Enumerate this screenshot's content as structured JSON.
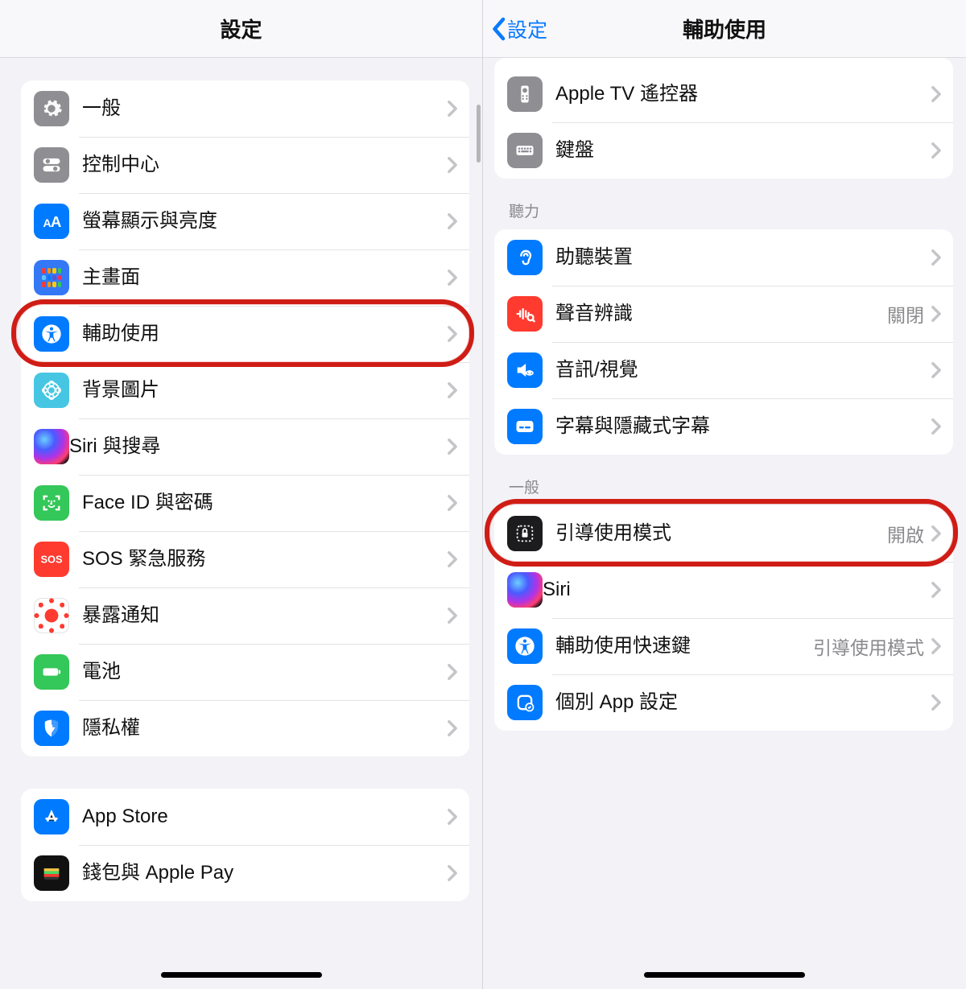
{
  "left": {
    "title": "設定",
    "groups": [
      {
        "rows": [
          {
            "label": "一般",
            "icon": "gear-icon",
            "bg": "bg-gray"
          },
          {
            "label": "控制中心",
            "icon": "toggles-icon",
            "bg": "bg-gray"
          },
          {
            "label": "螢幕顯示與亮度",
            "icon": "text-size-icon",
            "bg": "bg-blue"
          },
          {
            "label": "主畫面",
            "icon": "home-grid-icon",
            "bg": "bg-indigo"
          },
          {
            "label": "輔助使用",
            "icon": "accessibility-icon",
            "bg": "bg-blue",
            "highlight": true
          },
          {
            "label": "背景圖片",
            "icon": "wallpaper-icon",
            "bg": "bg-teal"
          },
          {
            "label": "Siri 與搜尋",
            "icon": "siri-icon",
            "bg": "bg-darkb"
          },
          {
            "label": "Face ID 與密碼",
            "icon": "faceid-icon",
            "bg": "bg-green"
          },
          {
            "label": "SOS 緊急服務",
            "icon": "sos-icon",
            "bg": "bg-red"
          },
          {
            "label": "暴露通知",
            "icon": "exposure-icon",
            "bg": "bg-white"
          },
          {
            "label": "電池",
            "icon": "battery-icon",
            "bg": "bg-green"
          },
          {
            "label": "隱私權",
            "icon": "privacy-icon",
            "bg": "bg-blue"
          }
        ]
      },
      {
        "rows": [
          {
            "label": "App Store",
            "icon": "appstore-icon",
            "bg": "bg-blue"
          },
          {
            "label": "錢包與 Apple Pay",
            "icon": "wallet-icon",
            "bg": "bg-black"
          }
        ]
      }
    ]
  },
  "right": {
    "back_label": "設定",
    "title": "輔助使用",
    "top_group": {
      "rows": [
        {
          "label": "Apple TV 遙控器",
          "icon": "remote-icon",
          "bg": "bg-gray"
        },
        {
          "label": "鍵盤",
          "icon": "keyboard-icon",
          "bg": "bg-gray"
        }
      ]
    },
    "sections": [
      {
        "header": "聽力",
        "rows": [
          {
            "label": "助聽裝置",
            "icon": "ear-icon",
            "bg": "bg-blue"
          },
          {
            "label": "聲音辨識",
            "icon": "soundrec-icon",
            "bg": "bg-red",
            "value": "關閉"
          },
          {
            "label": "音訊/視覺",
            "icon": "audio-icon",
            "bg": "bg-blue"
          },
          {
            "label": "字幕與隱藏式字幕",
            "icon": "caption-icon",
            "bg": "bg-blue"
          }
        ]
      },
      {
        "header": "一般",
        "rows": [
          {
            "label": "引導使用模式",
            "icon": "guided-icon",
            "bg": "bg-lock",
            "value": "開啟",
            "highlight": true
          },
          {
            "label": "Siri",
            "icon": "siri-icon",
            "bg": "bg-darkb"
          },
          {
            "label": "輔助使用快速鍵",
            "icon": "accessibility-icon",
            "bg": "bg-blue",
            "value": "引導使用模式"
          },
          {
            "label": "個別 App 設定",
            "icon": "perapp-icon",
            "bg": "bg-blue"
          }
        ]
      }
    ]
  }
}
